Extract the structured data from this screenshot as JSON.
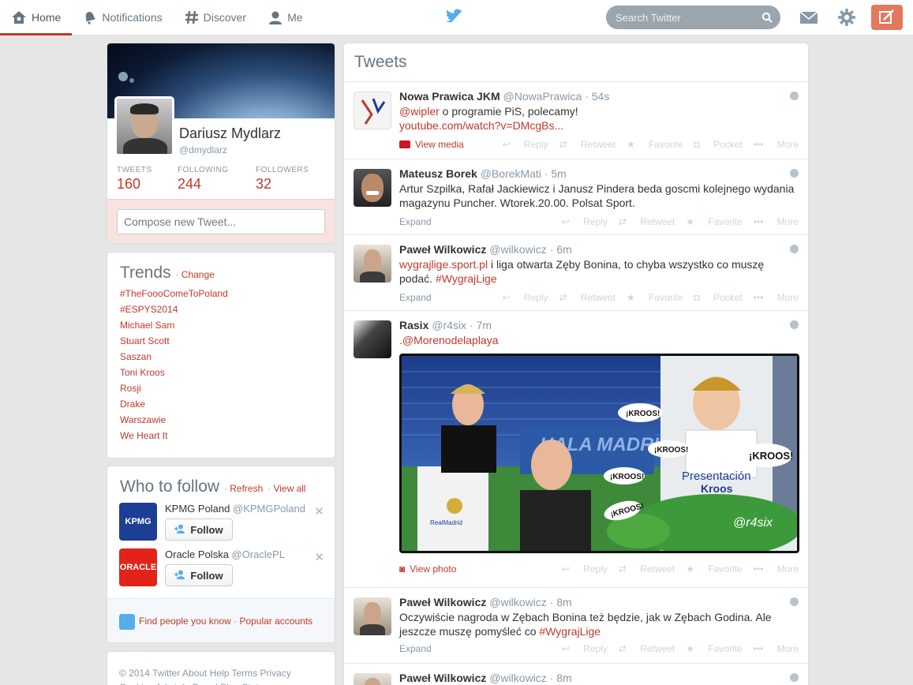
{
  "nav": {
    "home": "Home",
    "notifications": "Notifications",
    "discover": "Discover",
    "me": "Me"
  },
  "search": {
    "placeholder": "Search Twitter"
  },
  "profile": {
    "name": "Dariusz Mydlarz",
    "handle": "@dmydlarz",
    "tweets_label": "TWEETS",
    "tweets": "160",
    "following_label": "FOLLOWING",
    "following": "244",
    "followers_label": "FOLLOWERS",
    "followers": "32",
    "compose_placeholder": "Compose new Tweet..."
  },
  "trends": {
    "title": "Trends",
    "change": "Change",
    "items": [
      "#TheFoooComeToPoland",
      "#ESPYS2014",
      "Michael Sam",
      "Stuart Scott",
      "Saszan",
      "Toni Kroos",
      "Rosji",
      "Drake",
      "Warszawie",
      "We Heart It"
    ]
  },
  "wtf": {
    "title": "Who to follow",
    "refresh": "Refresh",
    "view_all": "View all",
    "follow_label": "Follow",
    "accounts": [
      {
        "name": "KPMG Poland",
        "handle": "@KPMGPoland",
        "logo_text": "KPMG"
      },
      {
        "name": "Oracle Polska",
        "handle": "@OraclePL",
        "logo_text": "ORACLE"
      }
    ],
    "find_people": "Find people you know",
    "popular": "Popular accounts"
  },
  "footer": {
    "text": "© 2014 Twitter  About  Help  Terms  Privacy  Cookies  Ads info  Brand  Blog  Status"
  },
  "stream": {
    "title": "Tweets",
    "actions": {
      "reply": "Reply",
      "retweet": "Retweet",
      "favorite": "Favorite",
      "pocket": "Pocket",
      "more": "More"
    },
    "expand": "Expand",
    "view_media": "View media",
    "view_photo": "View photo",
    "tweets": [
      {
        "name": "Nowa Prawica JKM",
        "handle": "@NowaPrawica",
        "time": "54s",
        "mention": "@wipler",
        "text": " o programie PiS, polecamy!",
        "link": "youtube.com/watch?v=DMcgBs..."
      },
      {
        "name": "Mateusz Borek",
        "handle": "@BorekMati",
        "time": "5m",
        "text": "Artur Szpilka, Rafał Jackiewicz i Janusz Pindera beda goscmi kolejnego wydania magazynu Puncher. Wtorek.20.00. Polsat Sport."
      },
      {
        "name": "Paweł Wilkowicz",
        "handle": "@wilkowicz",
        "time": "6m",
        "link": "wygrajlige.sport.pl",
        "text": " i liga otwarta Zęby Bonina, to chyba wszystko co muszę podać.  ",
        "hashtag": "#WygrajLige"
      },
      {
        "name": "Rasix",
        "handle": "@r4six",
        "time": "7m",
        "mention": ".@Morenodelaplaya",
        "photo_texts": [
          "¡KROOS!",
          "¡KROOS!",
          "¡KROOS!",
          "¡KROOS!",
          "¡KROOS!",
          "Presentación",
          "Kroos",
          "@r4six",
          "RealMadrid"
        ]
      },
      {
        "name": "Paweł Wilkowicz",
        "handle": "@wilkowicz",
        "time": "8m",
        "text": "Oczywiście nagroda w Zębach Bonina też będzie, jak w Zębach Godina. Ale jeszcze muszę pomyśleć co ",
        "hashtag": "#WygrajLige"
      },
      {
        "name": "Paweł Wilkowicz",
        "handle": "@wilkowicz",
        "time": "8m"
      }
    ]
  }
}
